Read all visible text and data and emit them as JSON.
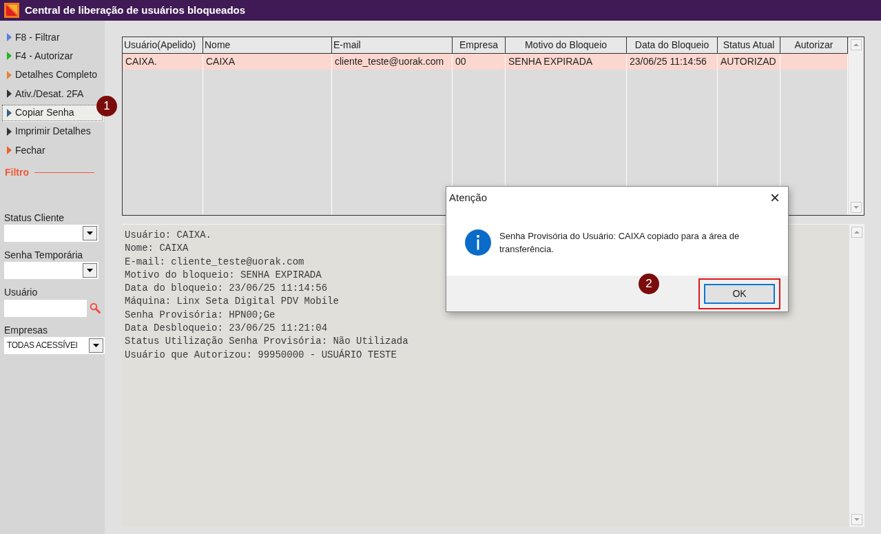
{
  "window": {
    "title": "Central de liberação de usuários bloqueados"
  },
  "sidebar": {
    "items": [
      {
        "label": "F8 - Filtrar",
        "color": "#5b7fe0",
        "focused": false
      },
      {
        "label": "F4 - Autorizar",
        "color": "#1fb81f",
        "focused": false
      },
      {
        "label": "Detalhes Completo",
        "color": "#e8803c",
        "focused": false
      },
      {
        "label": "Ativ./Desat. 2FA",
        "color": "#333333",
        "focused": false
      },
      {
        "label": "Copiar Senha",
        "color": "#3b5f80",
        "focused": true
      },
      {
        "label": "Imprimir Detalhes",
        "color": "#333333",
        "focused": false
      },
      {
        "label": "Fechar",
        "color": "#f0602c",
        "focused": false
      }
    ],
    "filter_title": "Filtro",
    "fields": [
      {
        "kind": "combo",
        "label": "Status Cliente"
      },
      {
        "kind": "combo",
        "label": "Senha Temporária"
      },
      {
        "kind": "search",
        "label": "Usuário"
      },
      {
        "kind": "combo",
        "label": "Empresas",
        "value": "TODAS ACESSÍVEI"
      }
    ]
  },
  "table": {
    "columns": [
      "Usuário(Apelido)",
      "Nome",
      "E-mail",
      "Empresa",
      "Motivo do Bloqueio",
      "Data do Bloqueio",
      "Status Atual",
      "Autorizar"
    ],
    "rows": [
      {
        "selected": true,
        "cells": [
          "CAIXA.",
          "CAIXA",
          "cliente_teste@uorak.com",
          "00",
          "SENHA EXPIRADA",
          "23/06/25 11:14:56",
          "AUTORIZAD"
        ]
      }
    ]
  },
  "details": [
    "Usuário: CAIXA.",
    "Nome: CAIXA",
    "E-mail: cliente_teste@uorak.com",
    "Motivo do bloqueio: SENHA EXPIRADA",
    "Data do bloqueio: 23/06/25 11:14:56",
    "Máquina: Linx Seta Digital PDV Mobile",
    "Senha Provisória: HPN00;Ge",
    "Data Desbloqueio: 23/06/25 11:21:04",
    "Status Utilização Senha Provisória: Não Utilizada",
    "Usuário que Autorizou: 99950000 - USUÁRIO TESTE"
  ],
  "dialog": {
    "title": "Atenção",
    "close": "×",
    "message": "Senha Provisória do Usuário: CAIXA copiado para a área de transferência.",
    "ok_button": {
      "label": "OK",
      "highlighted": true
    }
  },
  "markers": [
    {
      "label": "1"
    },
    {
      "label": "2"
    }
  ]
}
